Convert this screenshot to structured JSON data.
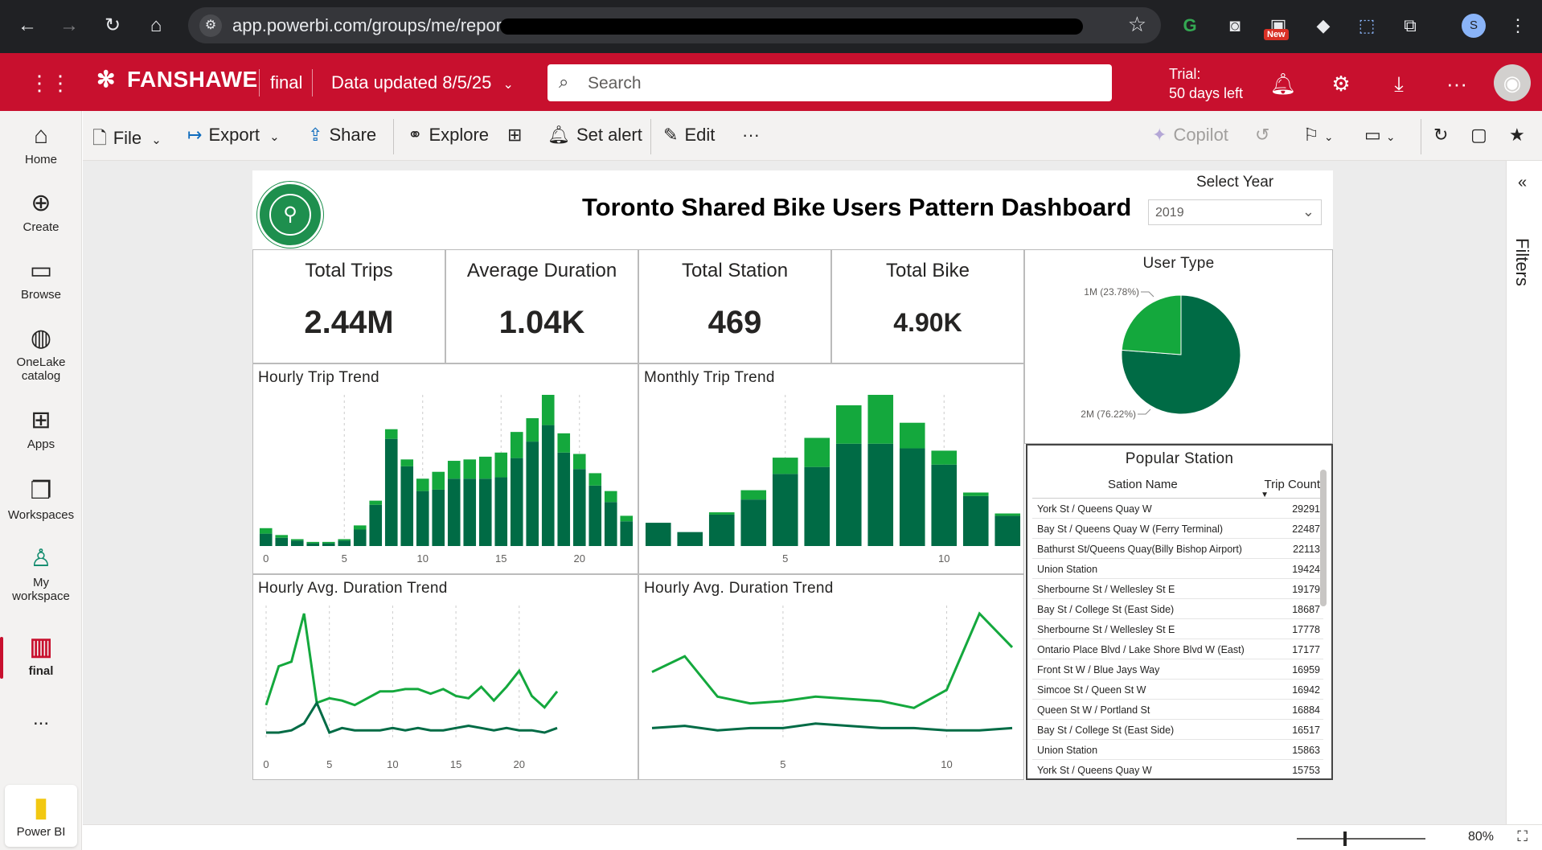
{
  "browser": {
    "url": "app.powerbi.com/groups/me/reports",
    "new_badge": "New",
    "profile_initial": "S"
  },
  "header": {
    "brand": "FANSHAWE",
    "report_name": "final",
    "data_updated": "Data updated 8/5/25",
    "search_placeholder": "Search",
    "trial_line1": "Trial:",
    "trial_line2": "50 days left"
  },
  "leftnav": {
    "items": [
      {
        "label": "Home",
        "icon": "home-icon"
      },
      {
        "label": "Create",
        "icon": "plus-circle-icon"
      },
      {
        "label": "Browse",
        "icon": "folder-icon"
      },
      {
        "label": "OneLake",
        "label2": "catalog",
        "icon": "onelake-icon"
      },
      {
        "label": "Apps",
        "icon": "apps-icon"
      },
      {
        "label": "Workspaces",
        "icon": "workspaces-icon"
      },
      {
        "label": "My",
        "label2": "workspace",
        "icon": "person-icon"
      },
      {
        "label": "final",
        "icon": "report-icon"
      }
    ],
    "more": "...",
    "app_label": "Power BI"
  },
  "toolbar": {
    "file": "File",
    "export": "Export",
    "share": "Share",
    "explore": "Explore",
    "set_alert": "Set alert",
    "edit": "Edit",
    "more": "···",
    "copilot": "Copilot"
  },
  "filters_label": "Filters",
  "zoom": "80%",
  "report": {
    "title": "Toronto Shared Bike Users Pattern Dashboard",
    "select_year_label": "Select Year",
    "selected_year": "2019",
    "cards": [
      {
        "label": "Total Trips",
        "value": "2.44M"
      },
      {
        "label": "Average Duration",
        "value": "1.04K"
      },
      {
        "label": "Total Station",
        "value": "469"
      },
      {
        "label": "Total Bike",
        "value": "4.90K"
      }
    ],
    "user_type_title": "User Type",
    "popular_station": {
      "title": "Popular Station",
      "col_name": "Sation Name",
      "col_count": "Trip Count",
      "rows": [
        {
          "name": "York St / Queens Quay W",
          "count": "29291"
        },
        {
          "name": "Bay St / Queens Quay W (Ferry Terminal)",
          "count": "22487"
        },
        {
          "name": "Bathurst St/Queens Quay(Billy Bishop Airport)",
          "count": "22113"
        },
        {
          "name": "Union Station",
          "count": "19424"
        },
        {
          "name": "Sherbourne St / Wellesley St E",
          "count": "19179"
        },
        {
          "name": "Bay St / College St (East Side)",
          "count": "18687"
        },
        {
          "name": "Sherbourne St / Wellesley St E",
          "count": "17778"
        },
        {
          "name": "Ontario Place Blvd / Lake Shore Blvd W (East)",
          "count": "17177"
        },
        {
          "name": "Front St W / Blue Jays Way",
          "count": "16959"
        },
        {
          "name": "Simcoe St / Queen St W",
          "count": "16942"
        },
        {
          "name": "Queen St W / Portland St",
          "count": "16884"
        },
        {
          "name": "Bay St / College St (East Side)",
          "count": "16517"
        },
        {
          "name": "Union Station",
          "count": "15863"
        },
        {
          "name": "York St / Queens Quay W",
          "count": "15753"
        }
      ]
    }
  },
  "colors": {
    "brand_red": "#c8102e",
    "dark_green": "#006b45",
    "light_green": "#14a83d"
  },
  "chart_data": [
    {
      "type": "bar",
      "title": "Hourly Trip Trend",
      "x": [
        0,
        1,
        2,
        3,
        4,
        5,
        6,
        7,
        8,
        9,
        10,
        11,
        12,
        13,
        14,
        15,
        16,
        17,
        18,
        19,
        20,
        21,
        22,
        23
      ],
      "tick_labels": [
        "0",
        "5",
        "10",
        "15",
        "20"
      ],
      "series": [
        {
          "values": [
            9,
            6,
            4,
            2,
            2,
            4,
            12,
            30,
            78,
            58,
            40,
            41,
            49,
            49,
            49,
            50,
            64,
            76,
            88,
            68,
            56,
            44,
            32,
            18
          ]
        },
        {
          "values": [
            4,
            2,
            1,
            1,
            1,
            1,
            3,
            3,
            7,
            5,
            9,
            13,
            13,
            14,
            16,
            18,
            19,
            17,
            22,
            14,
            11,
            9,
            8,
            4
          ]
        }
      ]
    },
    {
      "type": "bar",
      "title": "Monthly Trip Trend",
      "x": [
        1,
        2,
        3,
        4,
        5,
        6,
        7,
        8,
        9,
        10,
        11,
        12
      ],
      "tick_labels": [
        "5",
        "10"
      ],
      "series": [
        {
          "values": [
            20,
            12,
            27,
            40,
            62,
            68,
            88,
            88,
            84,
            70,
            43,
            26
          ]
        },
        {
          "values": [
            0,
            0,
            2,
            8,
            14,
            25,
            33,
            42,
            22,
            12,
            3,
            2
          ]
        }
      ]
    },
    {
      "type": "pie",
      "title": "User Type",
      "slices": [
        {
          "label": "2M (76.22%)",
          "value": 76.22
        },
        {
          "label": "1M (23.78%)",
          "value": 23.78
        }
      ]
    },
    {
      "type": "line",
      "title": "Hourly Avg. Duration Trend",
      "x": [
        0,
        1,
        2,
        3,
        4,
        5,
        6,
        7,
        8,
        9,
        10,
        11,
        12,
        13,
        14,
        15,
        16,
        17,
        18,
        19,
        20,
        21,
        22,
        23
      ],
      "tick_labels": [
        "0",
        "5",
        "10",
        "15",
        "20"
      ],
      "series": [
        {
          "values": [
            1.2,
            2.9,
            3.1,
            5.2,
            1.3,
            1.5,
            1.4,
            1.2,
            1.5,
            1.8,
            1.8,
            1.9,
            1.9,
            1.7,
            1.9,
            1.6,
            1.5,
            2.0,
            1.4,
            2.0,
            2.7,
            1.6,
            1.1,
            1.8
          ]
        },
        {
          "values": [
            0,
            0,
            0.1,
            0.4,
            1.3,
            0,
            0.2,
            0.1,
            0.1,
            0.1,
            0.2,
            0.1,
            0.2,
            0.1,
            0.1,
            0.2,
            0.3,
            0.2,
            0.1,
            0.2,
            0.1,
            0.1,
            0,
            0.2
          ]
        }
      ]
    },
    {
      "type": "line",
      "title": "Hourly Avg. Duration Trend",
      "x": [
        1,
        2,
        3,
        4,
        5,
        6,
        7,
        8,
        9,
        10,
        11,
        12
      ],
      "tick_labels": [
        "5",
        "10"
      ],
      "series": [
        {
          "values": [
            2.7,
            3.4,
            1.6,
            1.3,
            1.4,
            1.6,
            1.5,
            1.4,
            1.1,
            1.9,
            5.3,
            3.8
          ]
        },
        {
          "values": [
            0.2,
            0.3,
            0.1,
            0.2,
            0.2,
            0.4,
            0.3,
            0.2,
            0.2,
            0.1,
            0.1,
            0.2
          ]
        }
      ]
    }
  ]
}
